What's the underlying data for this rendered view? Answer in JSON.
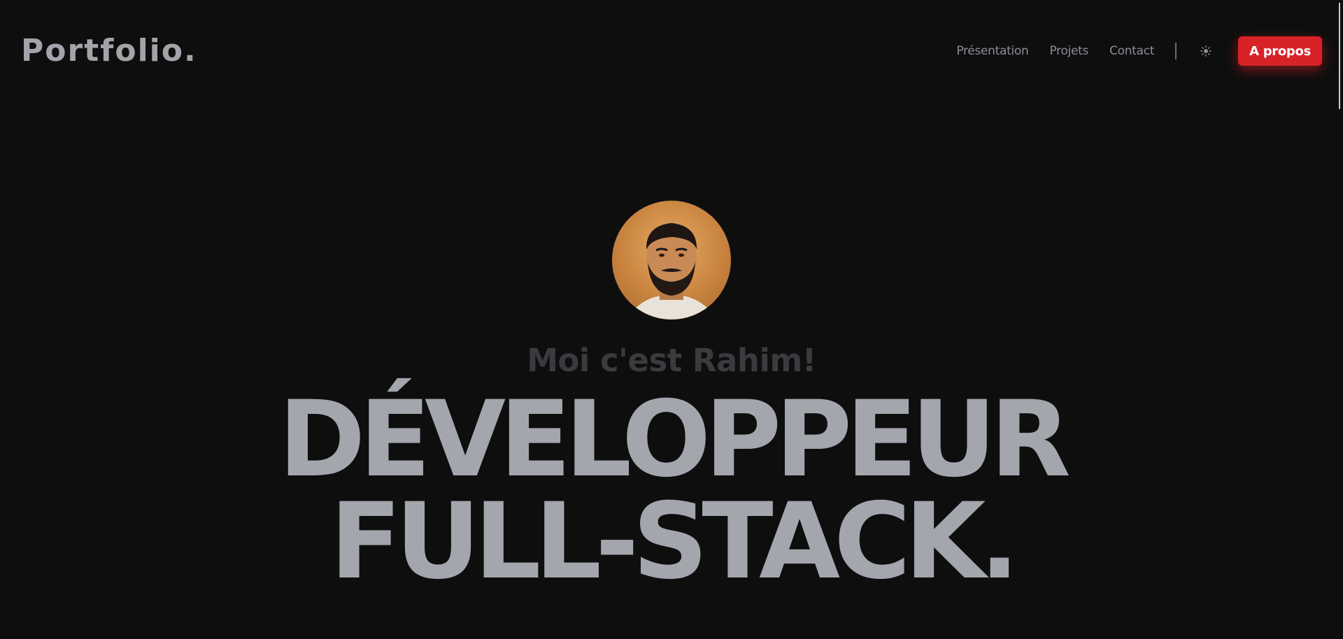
{
  "header": {
    "logo": "Portfolio.",
    "nav": {
      "items": [
        {
          "label": "Présentation"
        },
        {
          "label": "Projets"
        },
        {
          "label": "Contact"
        }
      ],
      "theme_icon": "sun-icon",
      "about_label": "A propos"
    }
  },
  "hero": {
    "intro": "Moi c'est Rahim!",
    "headline_line1": "DÉVELOPPEUR",
    "headline_line2": "FULL-STACK."
  },
  "colors": {
    "background": "#0e0e0e",
    "accent": "#d72228",
    "headline": "#a4a6ae",
    "intro": "#3a3b3f",
    "nav_text": "#8c8e96"
  }
}
